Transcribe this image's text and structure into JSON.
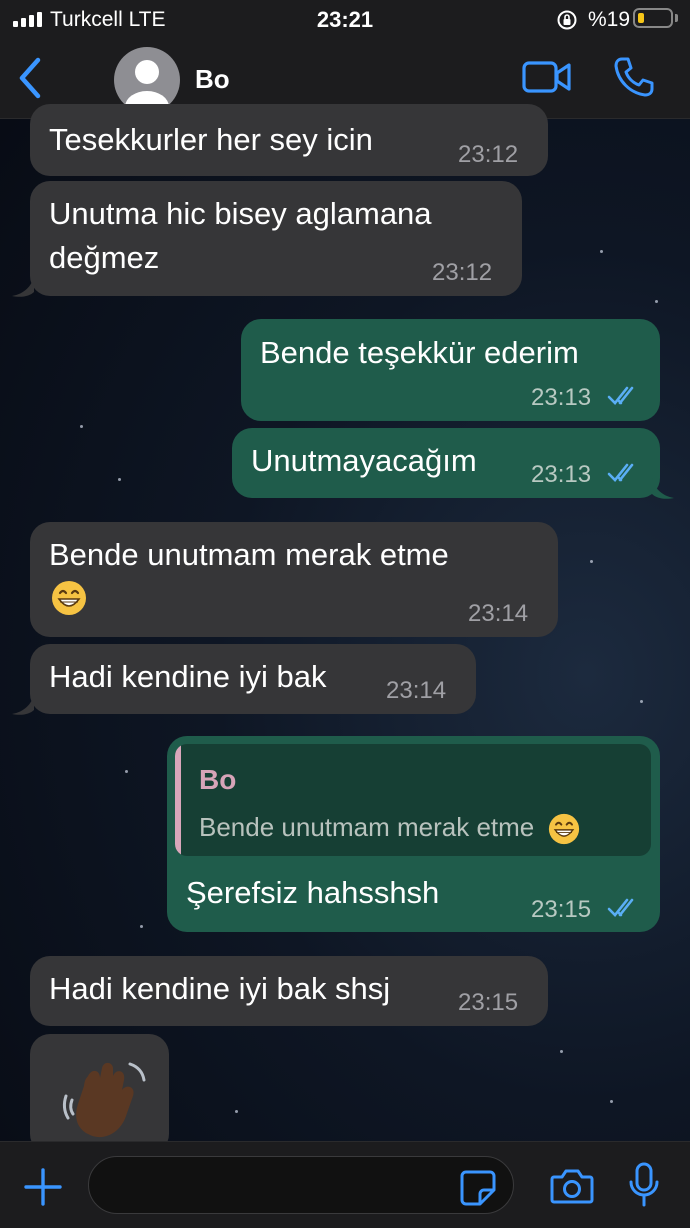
{
  "status_bar": {
    "carrier": "Turkcell   LTE",
    "time": "23:21",
    "battery_text": "%19",
    "battery_level": 0.19
  },
  "header": {
    "contact_name": "Bo"
  },
  "colors": {
    "accent": "#3a95ff",
    "incoming_bubble": "#363638",
    "outgoing_bubble": "#1f5c4b",
    "read_ticks": "#5aaef5",
    "quote_bar": "#d9a7bb",
    "battery": "#f5c518"
  },
  "messages": [
    {
      "direction": "incoming",
      "text": "Tesekkurler her sey icin",
      "time": "23:12"
    },
    {
      "direction": "incoming",
      "lines": [
        "Unutma hic bisey aglamana",
        "değmez"
      ],
      "time": "23:12"
    },
    {
      "direction": "outgoing",
      "text": "Bende teşekkür ederim",
      "time": "23:13",
      "status": "read-double-check-icon"
    },
    {
      "direction": "outgoing",
      "text": "Unutmayacağım",
      "time": "23:13",
      "status": "read-double-check-icon"
    },
    {
      "direction": "incoming",
      "lines": [
        "Bende unutmam merak etme"
      ],
      "emoji": "grinning-face-emoji",
      "time": "23:14"
    },
    {
      "direction": "incoming",
      "text": "Hadi kendine iyi bak",
      "time": "23:14"
    },
    {
      "direction": "outgoing",
      "quote": {
        "name": "Bo",
        "text": "Bende unutmam merak etme",
        "emoji": "grinning-face-emoji"
      },
      "text": "Şerefsiz hahsshsh",
      "time": "23:15",
      "status": "read-double-check-icon"
    },
    {
      "direction": "incoming",
      "text": "Hadi kendine iyi bak shsj",
      "time": "23:15"
    },
    {
      "direction": "incoming",
      "emoji": "waving-hand-emoji"
    }
  ],
  "input": {
    "placeholder": ""
  },
  "icons": [
    "back-icon",
    "avatar-icon",
    "video-call-icon",
    "phone-call-icon",
    "plus-icon",
    "sticker-icon",
    "camera-icon",
    "microphone-icon"
  ]
}
